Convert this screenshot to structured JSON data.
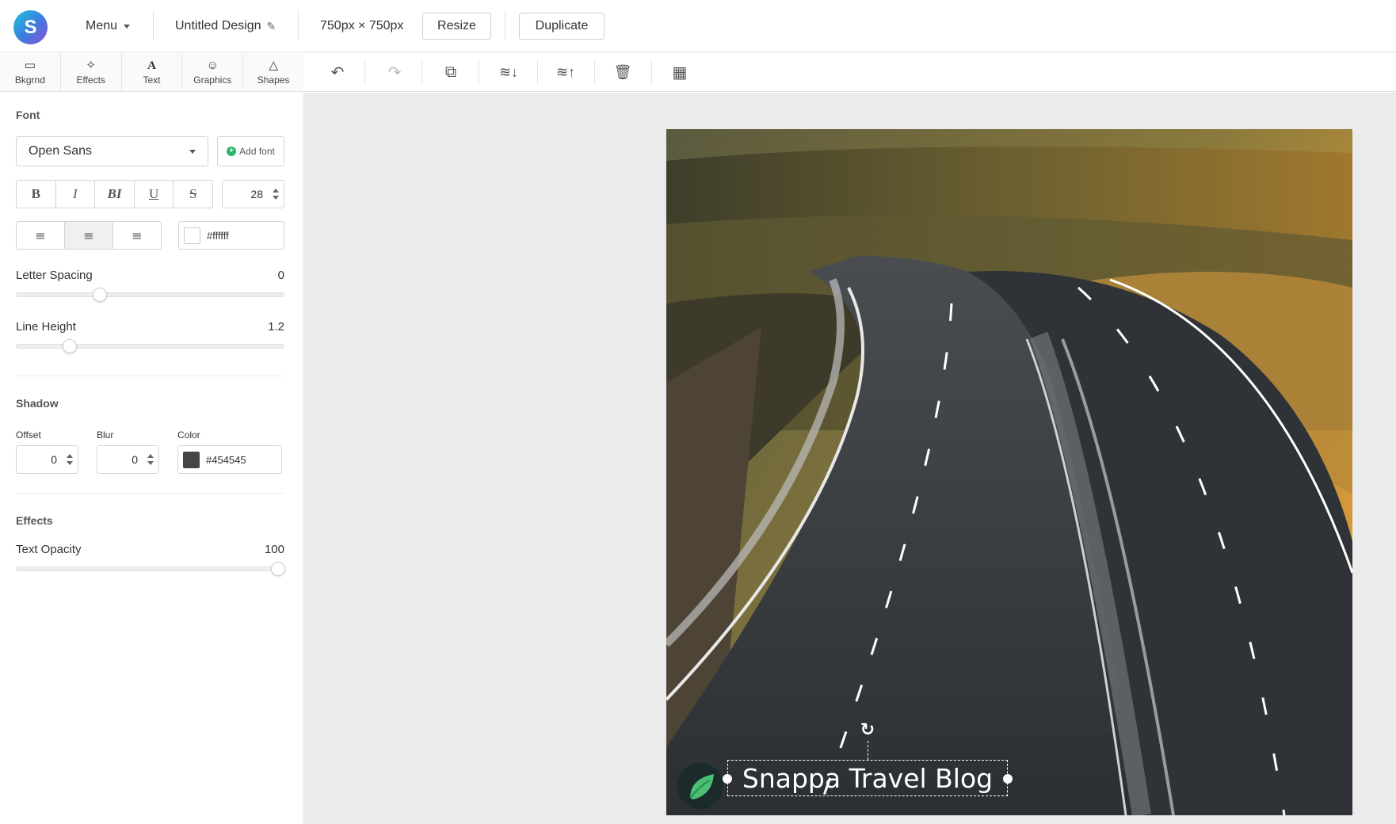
{
  "app": {
    "logo_letter": "S",
    "menu_label": "Menu",
    "design_title": "Untitled Design",
    "dimensions": "750px × 750px",
    "resize_label": "Resize",
    "duplicate_label": "Duplicate"
  },
  "tool_tabs": [
    {
      "label": "Bkgrnd",
      "icon": "image-icon",
      "glyph": "🖼"
    },
    {
      "label": "Effects",
      "icon": "magic-wand-icon",
      "glyph": "✎"
    },
    {
      "label": "Text",
      "icon": "text-icon",
      "glyph": "A"
    },
    {
      "label": "Graphics",
      "icon": "smiley-icon",
      "glyph": "☺"
    },
    {
      "label": "Shapes",
      "icon": "triangle-icon",
      "glyph": "△"
    }
  ],
  "canvas_toolbar": {
    "undo": "↶",
    "redo": "↷",
    "copy": "⧉",
    "layer_down": "≋↓",
    "layer_up": "≋↑",
    "delete": "🗑",
    "grid": "▦"
  },
  "font": {
    "section_title": "Font",
    "family": "Open Sans",
    "add_font_label": "Add font",
    "style_buttons": [
      "B",
      "I",
      "BI",
      "U",
      "S"
    ],
    "size": "28",
    "color": "#ffffff",
    "color_label": "#ffffff"
  },
  "letter_spacing": {
    "label": "Letter Spacing",
    "value": "0",
    "fraction": 0.3
  },
  "line_height": {
    "label": "Line Height",
    "value": "1.2",
    "fraction": 0.18
  },
  "shadow": {
    "section_title": "Shadow",
    "offset_label": "Offset",
    "offset_value": "0",
    "blur_label": "Blur",
    "blur_value": "0",
    "color_label": "Color",
    "color": "#454545",
    "color_text": "#454545"
  },
  "effects": {
    "section_title": "Effects",
    "opacity_label": "Text Opacity",
    "opacity_value": "100",
    "fraction": 1.0
  },
  "canvas": {
    "text": "Snappa Travel Blog"
  }
}
